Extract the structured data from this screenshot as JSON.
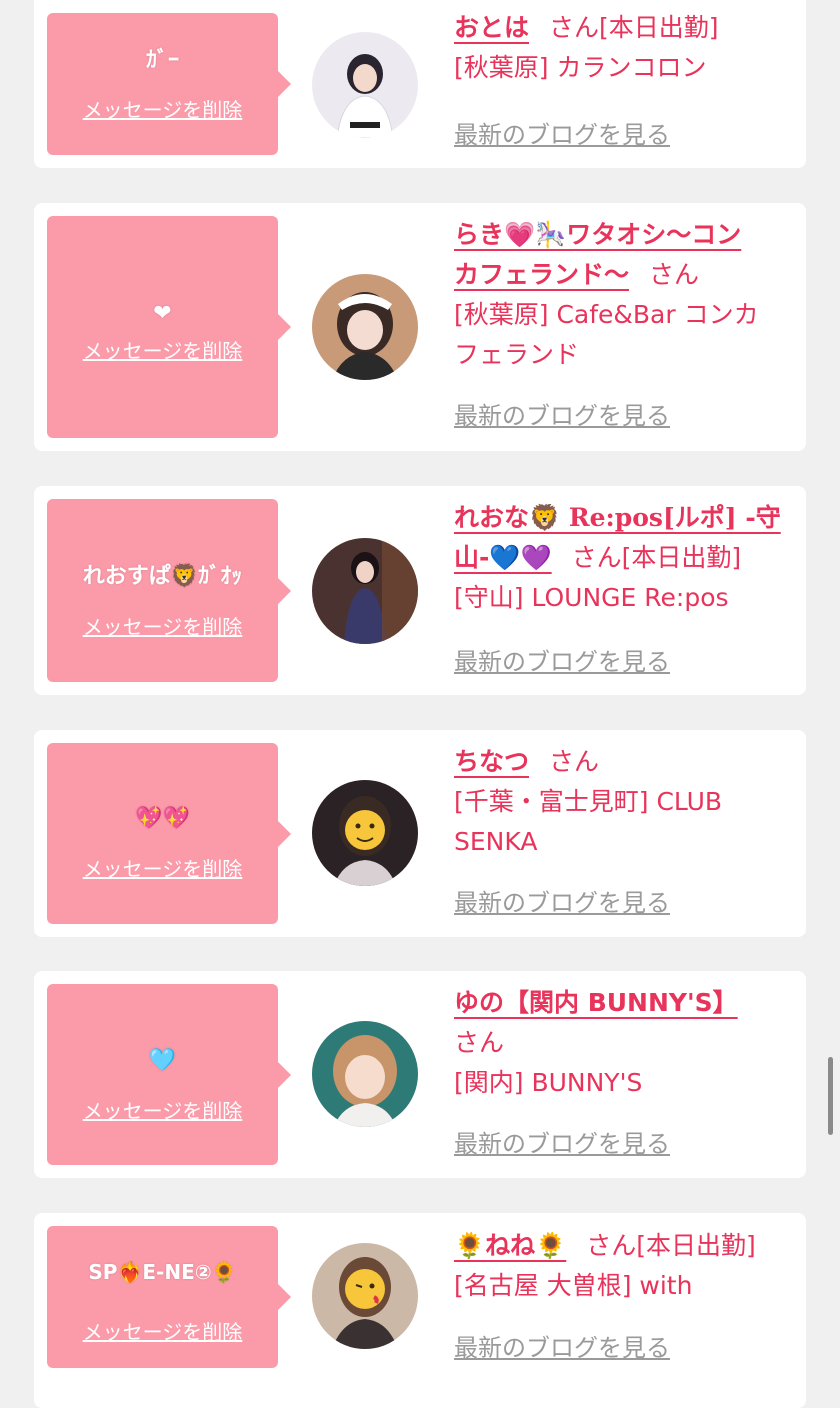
{
  "delete_label": "メッセージを削除",
  "blog_label": "最新のブログを見る",
  "san": "さん",
  "cards": [
    {
      "message": "ｶﾞｰ",
      "name": "おとは",
      "on_duty": "[本日出勤]",
      "location": "[秋葉原] カランコロン"
    },
    {
      "message": "❤",
      "name_line1": "らき💗🎠ワタオシ〜コン",
      "name_line2": "カフェランド〜",
      "location_line1": "[秋葉原] Cafe&Bar コンカ",
      "location_line2": "フェランド"
    },
    {
      "message": "れおすぱ🦁ｶﾞｵｯ",
      "name_line1": "れおな🦁 Re:pos[ルポ] -守",
      "name_line2": "山-💙💜",
      "on_duty": "[本日出勤]",
      "location": "[守山] LOUNGE Re:pos"
    },
    {
      "message": "💖💖",
      "name": "ちなつ",
      "location_line1": "[千葉・富士見町] CLUB",
      "location_line2": "SENKA"
    },
    {
      "message": "🩵",
      "name": "ゆの【関内 BUNNY'S】",
      "location": "[関内] BUNNY'S"
    },
    {
      "message": "SP❤️‍🔥E-NE②🌻",
      "name": "🌻ねね🌻",
      "on_duty": "[本日出勤]",
      "location": "[名古屋 大曽根] with"
    }
  ],
  "colors": {
    "bubble": "#fb9aa8",
    "accent": "#e8335a",
    "link_gray": "#9a9a9a",
    "background": "#f0f0f0"
  }
}
